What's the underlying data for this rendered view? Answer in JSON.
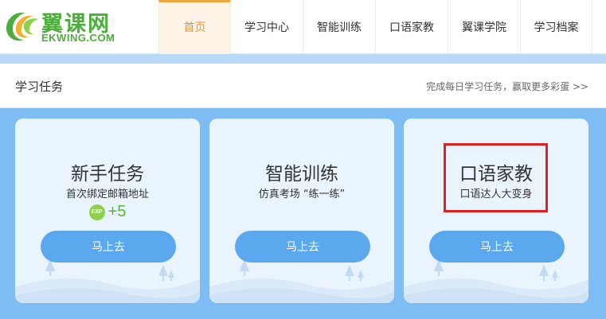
{
  "logo": {
    "cn": "翼课网",
    "en": "EKWING.COM",
    "icon": "ekwing-logo-icon"
  },
  "nav": {
    "items": [
      {
        "label": "首页",
        "active": true
      },
      {
        "label": "学习中心",
        "active": false
      },
      {
        "label": "智能训练",
        "active": false
      },
      {
        "label": "口语家教",
        "active": false
      },
      {
        "label": "翼课学院",
        "active": false
      },
      {
        "label": "学习档案",
        "active": false
      }
    ]
  },
  "tasks": {
    "title": "学习任务",
    "more": "完成每日学习任务，赢取更多彩蛋 >>",
    "cards": [
      {
        "title": "新手任务",
        "subtitle": "首次绑定邮箱地址",
        "reward_badge": "EXP",
        "reward": "+5",
        "button": "马上去"
      },
      {
        "title": "智能训练",
        "subtitle": "仿真考场 “练一练”",
        "button": "马上去"
      },
      {
        "title": "口语家教",
        "subtitle": "口语达人大变身",
        "button": "马上去"
      }
    ]
  },
  "colors": {
    "brand_green": "#4cae3a",
    "active_orange": "#e8962a",
    "panel_blue": "#7dbdf4",
    "button_blue": "#5ba8ee",
    "highlight_red": "#e02020"
  }
}
